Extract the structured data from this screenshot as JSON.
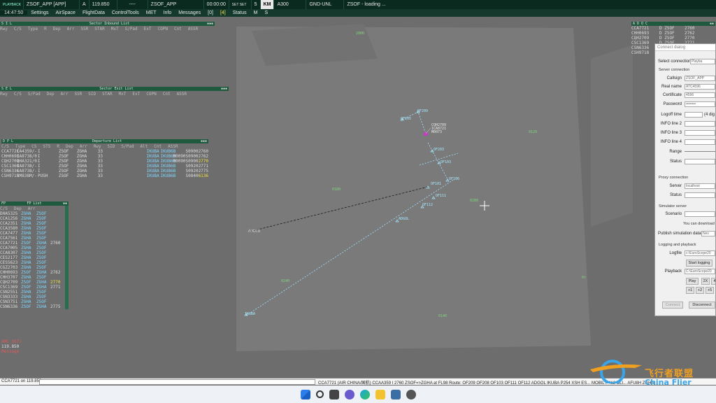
{
  "topbar": {
    "mode": "PLAYBACK",
    "callsign": "ZSOF_APP [APP]",
    "freq_flag": "A",
    "freq": "119.850",
    "dashes": "----",
    "sct_name": "ZSOF_APP",
    "time": "00:00:00",
    "set_labels": "SET SET",
    "range_val": "5",
    "range_unit": "KM",
    "alt": "A300",
    "gnd": "GND-UNL",
    "loading": "ZSOF - loading ..."
  },
  "menubar": {
    "clock": "14:47:50",
    "items": [
      "Settings",
      "AirSpace",
      "FlightData",
      "ControlTools",
      "MET",
      "Info",
      "Messages"
    ],
    "count": "[0]",
    "count2": "[4]",
    "status": "Status",
    "m": "M",
    "s": "S"
  },
  "sector_inbound": {
    "title": "Sector Inbound List",
    "cols": [
      "Rwy",
      "C/S",
      "Type",
      "R",
      "Dep",
      "Arr",
      "SSR",
      "STAR",
      "MxT",
      "S/Pad",
      "ExT",
      "COPN",
      "Cnt",
      "ASSR"
    ]
  },
  "sector_exit": {
    "title": "Sector Exit List",
    "cols": [
      "Rwy",
      "C/S",
      "S/Pad",
      "Dep",
      "Arr",
      "SSR",
      "SID",
      "STAR",
      "MxT",
      "ExT",
      "COPN",
      "Cnt",
      "ASSR"
    ]
  },
  "departure": {
    "title": "Departure List",
    "cols": [
      "C/S",
      "Type",
      "CS",
      "STS",
      "R",
      "Dep",
      "Arr",
      "Rwy",
      "SID",
      "S/Pad",
      "Alt",
      "Cnt",
      "ASSR"
    ],
    "rows": [
      [
        "CCA7721",
        "CA4359/-",
        "I",
        "ZSOF",
        "ZGHA",
        "33",
        "IKUBA",
        "",
        "S0900",
        "2760",
        ""
      ],
      [
        "CHH0693",
        "CA8738/0",
        "I",
        "ZSOF",
        "ZGHA",
        "33",
        "IKUBA",
        "M0090",
        "S0900",
        "2762",
        ""
      ],
      [
        "CQH2709",
        "QHA321/0",
        "I",
        "ZSOF",
        "ZGHA",
        "33",
        "IKUBA",
        "M0090",
        "S0900",
        "2770",
        "y"
      ],
      [
        "CSC1369",
        "CA8738/-",
        "I",
        "ZSOF",
        "ZGHA",
        "33",
        "IKUBA",
        "",
        "S0920",
        "2771",
        ""
      ],
      [
        "CSN6336",
        "CA8738/-",
        "I",
        "ZSOF",
        "ZGHA",
        "33",
        "IKUBA",
        "",
        "S0920",
        "2775",
        ""
      ],
      [
        "CSH9718",
        "SM838M/-",
        "PUSH",
        "ZSOF",
        "ZGHA",
        "33",
        "IKUBA",
        "",
        "S0840",
        "6136",
        "y"
      ]
    ],
    "sid_label": "IKUB6B"
  },
  "fpl_list": {
    "title": "FP List",
    "cols": [
      "C/S",
      "Dep",
      "Arr"
    ],
    "rows": [
      [
        "DHA5325",
        "ZGHA",
        "ZSOF",
        ""
      ],
      [
        "CCA1256",
        "ZGHA",
        "ZSOF",
        ""
      ],
      [
        "CCA2351",
        "ZGHA",
        "ZSOF",
        ""
      ],
      [
        "CCA3580",
        "ZGHA",
        "ZSOF",
        ""
      ],
      [
        "CCA7477",
        "ZGHA",
        "ZSOF",
        ""
      ],
      [
        "CCA7561",
        "ZGHA",
        "ZSOF",
        ""
      ],
      [
        "CCA7721",
        "ZSOF",
        "ZGHA",
        "2760"
      ],
      [
        "CCA7005",
        "ZGHA",
        "ZSOF",
        ""
      ],
      [
        "CCA8307",
        "ZGHA",
        "ZSOF",
        ""
      ],
      [
        "CES2177",
        "ZGHA",
        "ZSOF",
        ""
      ],
      [
        "CES5623",
        "ZGHA",
        "ZSOF",
        ""
      ],
      [
        "CGZ2703",
        "ZGHA",
        "ZSOF",
        ""
      ],
      [
        "CHH0693",
        "ZSOF",
        "ZGHA",
        "2762"
      ],
      [
        "CHH3707",
        "ZGHA",
        "ZSOF",
        ""
      ],
      [
        "CQH2709",
        "ZSOF",
        "ZGHA",
        "2770"
      ],
      [
        "CSC1369",
        "ZSOF",
        "ZGHA",
        "2771"
      ],
      [
        "CSN2551",
        "ZGHA",
        "ZSOF",
        ""
      ],
      [
        "CSN3333",
        "ZGHA",
        "ZSOF",
        ""
      ],
      [
        "CSN3751",
        "ZGHA",
        "ZSOF",
        ""
      ],
      [
        "CSN6336",
        "ZSOF",
        "ZGHA",
        "2775"
      ]
    ]
  },
  "adoc": {
    "title": "A D O C",
    "rows": [
      [
        "CCA7721",
        "D ZSOF",
        "2760"
      ],
      [
        "CHH0693",
        "D ZSOF",
        "2762"
      ],
      [
        "CQH2709",
        "D ZSOF",
        "2770"
      ],
      [
        "CSC1369",
        "D ZSOF",
        "2771"
      ],
      [
        "CSN6336",
        "D ZSOF",
        "2775"
      ],
      [
        "CSH9718",
        "",
        ""
      ]
    ]
  },
  "waypoints": {
    "of209": "OF209",
    "of205": "OF205",
    "of103": "OF103",
    "of106": "OF106",
    "of101": "OF101",
    "of111": "OF111",
    "of112": "OF112",
    "adgol": "ADGOL",
    "ikuba": "IKUBA",
    "mdc": "MDCN",
    "aircraft": "CQH2709",
    "ac_line2": "1CA8721",
    "ac_line3": "M0073"
  },
  "sectors": [
    "2800",
    "0120",
    "0180",
    "0240",
    "0280",
    "0190",
    "0140",
    "0t"
  ],
  "dialog": {
    "title": "Connect dialog",
    "select_mode": "Select connection mode:",
    "mode_val": "Playba",
    "server_conn": "Server connection",
    "callsign_lbl": "Callsign",
    "callsign_val": "ZSOF_APP",
    "realname_lbl": "Real name",
    "realname_val": "ATC4596",
    "cert_lbl": "Certificate",
    "cert_val": "4596",
    "password_lbl": "Password",
    "password_val": "••••••••",
    "logoff_lbl": "Logoff time",
    "logoff_hint": "(4 dig",
    "info2": "INFO line 2",
    "info3": "INFO line 3",
    "info4": "INFO line 4",
    "range_lbl": "Range",
    "status_lbl": "Status",
    "proxy": "Proxy connection",
    "server_lbl": "Server",
    "server_val": "localhost",
    "status2_lbl": "Status",
    "sim": "Simulator server",
    "scenario_lbl": "Scenario",
    "download": "You can download",
    "publish": "Publish simulation data:",
    "publish_val": "Nev",
    "logging": "Logging and playback",
    "logfile_lbl": "Logfile",
    "logfile_val": "c:\\EuroScope20",
    "start_logging": "Start logging",
    "playback_lbl": "Playback",
    "playback_val": "C:\\EuroScope20",
    "play": "Play",
    "x2": "2X",
    "x4": "4",
    "p1": "+1",
    "p2": "+2",
    "p5": "+5",
    "connect": "Connect",
    "disconnect": "Disconnect"
  },
  "cmdbar": {
    "left": "CCA7721 on 119.850",
    "route": "CCA7721 (AIR CHINA/国航) CCAA359 I 2760 ZSOF=>ZGHA at FL98 Route: OF209 OF208 OF103 OF111 OF112 ADGOL IKUBA P254 XSH ES... MOBIL P412 CLI... AFU8H ZGHA"
  },
  "msgpanel": {
    "line1": "AMC_3671",
    "line2": "119.850",
    "line3": "Message"
  },
  "watermark": {
    "cn": "飞行者联盟",
    "en": "China Flier"
  }
}
